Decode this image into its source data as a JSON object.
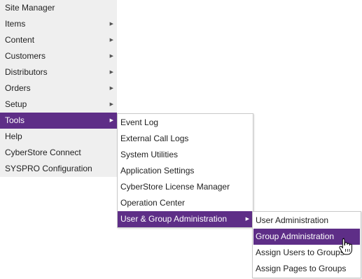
{
  "main_menu": {
    "items": [
      {
        "label": "Site Manager",
        "has_submenu": false
      },
      {
        "label": "Items",
        "has_submenu": true
      },
      {
        "label": "Content",
        "has_submenu": true
      },
      {
        "label": "Customers",
        "has_submenu": true
      },
      {
        "label": "Distributors",
        "has_submenu": true
      },
      {
        "label": "Orders",
        "has_submenu": true
      },
      {
        "label": "Setup",
        "has_submenu": true
      },
      {
        "label": "Tools",
        "has_submenu": true,
        "active": true
      },
      {
        "label": "Help",
        "has_submenu": false
      },
      {
        "label": "CyberStore Connect",
        "has_submenu": false
      },
      {
        "label": "SYSPRO Configuration",
        "has_submenu": false
      }
    ]
  },
  "tools_menu": {
    "items": [
      {
        "label": "Event Log"
      },
      {
        "label": "External Call Logs"
      },
      {
        "label": "System Utilities"
      },
      {
        "label": "Application Settings"
      },
      {
        "label": "CyberStore License Manager"
      },
      {
        "label": "Operation Center"
      },
      {
        "label": "User & Group Administration",
        "has_submenu": true,
        "active": true
      }
    ]
  },
  "group_menu": {
    "items": [
      {
        "label": "User Administration"
      },
      {
        "label": "Group Administration",
        "active": true
      },
      {
        "label": "Assign Users to Groups"
      },
      {
        "label": "Assign Pages to Groups"
      }
    ]
  },
  "colors": {
    "active_background": "#5e2e87",
    "menu_background": "#efefef",
    "submenu_border": "#c9c9c9"
  },
  "icons": {
    "submenu_arrow": "triangle-right-icon",
    "cursor": "hand-pointer-icon"
  }
}
